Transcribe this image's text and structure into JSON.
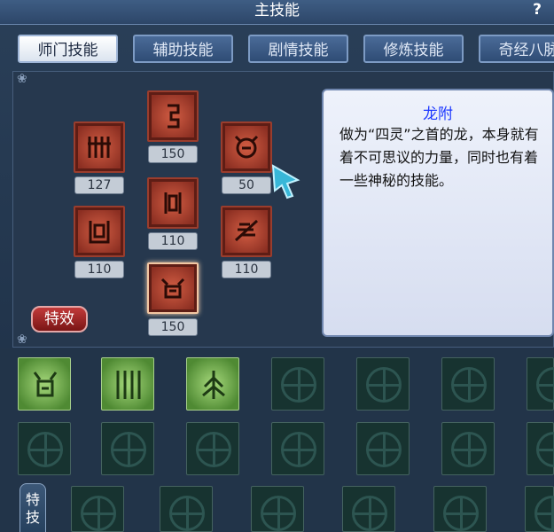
{
  "window": {
    "title": "主技能",
    "help_label": "?"
  },
  "tabs": [
    {
      "label": "师门技能",
      "active": true
    },
    {
      "label": "辅助技能",
      "active": false
    },
    {
      "label": "剧情技能",
      "active": false
    },
    {
      "label": "修炼技能",
      "active": false
    },
    {
      "label": "奇经八脉",
      "active": false
    }
  ],
  "skills": [
    {
      "icon": "rune-bars-icon",
      "level": "127"
    },
    {
      "icon": "rune-spiral-icon",
      "level": "150"
    },
    {
      "icon": "rune-beast-icon",
      "level": "50"
    },
    {
      "icon": "rune-seal-icon",
      "level": "110"
    },
    {
      "icon": "rune-gate-icon",
      "level": "110"
    },
    {
      "icon": "rune-dragon-icon",
      "level": "110"
    },
    {
      "icon": "rune-mask-icon",
      "level": "150"
    }
  ],
  "effect_button": {
    "label": "特效"
  },
  "description": {
    "title": "龙附",
    "text": "做为“四灵”之首的龙，本身就有着不可思议的力量，同时也有着一些神秘的技能。"
  },
  "side_tab": {
    "label": "特技"
  },
  "colors": {
    "title_blue": "#1d38ff",
    "skill_red": "#c9573f",
    "slot_green": "#4f8a33"
  }
}
